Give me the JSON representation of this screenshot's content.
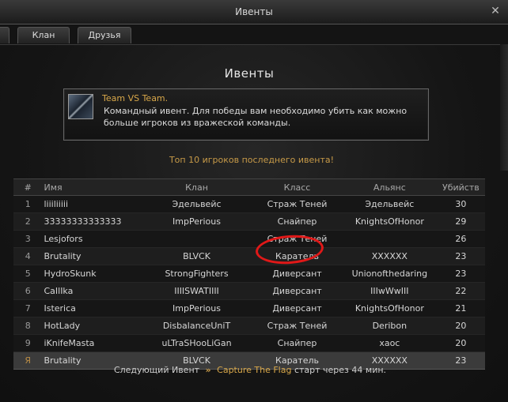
{
  "window": {
    "title": "Ивенты",
    "close_glyph": "✕"
  },
  "tabs": [
    {
      "label": ""
    },
    {
      "label": "Клан"
    },
    {
      "label": "Друзья"
    }
  ],
  "main": {
    "heading": "Ивенты"
  },
  "event": {
    "name": "Team VS Team.",
    "description": "Командный ивент. Для победы вам необходимо убить как можно больше игроков из вражеской команды.",
    "icon": "crossed-swords-icon"
  },
  "top_label": "Топ 10 игроков последнего ивента!",
  "table": {
    "headers": [
      "#",
      "Имя",
      "Клан",
      "Класс",
      "Альянс",
      "Убийств"
    ],
    "rows": [
      {
        "rank": "1",
        "name": "liiiliiiii",
        "clan": "Эдельвейс",
        "class": "Страж Теней",
        "alliance": "Эдельвейс",
        "kills": "30"
      },
      {
        "rank": "2",
        "name": "33333333333333",
        "clan": "ImpPerious",
        "class": "Снайпер",
        "alliance": "KnightsOfHonor",
        "kills": "29"
      },
      {
        "rank": "3",
        "name": "Lesjofors",
        "clan": "",
        "class": "Страж Теней",
        "alliance": "",
        "kills": "26"
      },
      {
        "rank": "4",
        "name": "Brutality",
        "clan": "BLVCK",
        "class": "Каратель",
        "alliance": "XXXXXX",
        "kills": "23"
      },
      {
        "rank": "5",
        "name": "HydroSkunk",
        "clan": "StrongFighters",
        "class": "Диверсант",
        "alliance": "Unionofthedaring",
        "kills": "23"
      },
      {
        "rank": "6",
        "name": "CaIlIka",
        "clan": "IIIISWATIIII",
        "class": "Диверсант",
        "alliance": "IIIwWwIII",
        "kills": "22"
      },
      {
        "rank": "7",
        "name": "Isterica",
        "clan": "ImpPerious",
        "class": "Диверсант",
        "alliance": "KnightsOfHonor",
        "kills": "21"
      },
      {
        "rank": "8",
        "name": "HotLady",
        "clan": "DisbalanceUniT",
        "class": "Страж Теней",
        "alliance": "Deribon",
        "kills": "20"
      },
      {
        "rank": "9",
        "name": "iKnifeMasta",
        "clan": "uLTraSHooLiGan",
        "class": "Снайпер",
        "alliance": "xaoc",
        "kills": "20"
      }
    ],
    "self_row": {
      "rank": "Я",
      "name": "Brutality",
      "clan": "BLVCK",
      "class": "Каратель",
      "alliance": "XXXXXX",
      "kills": "23"
    }
  },
  "next_event": {
    "prefix": "Следующий Ивент",
    "arrow": "»",
    "name": "Capture The Flag",
    "suffix": "старт через 44 мин."
  }
}
